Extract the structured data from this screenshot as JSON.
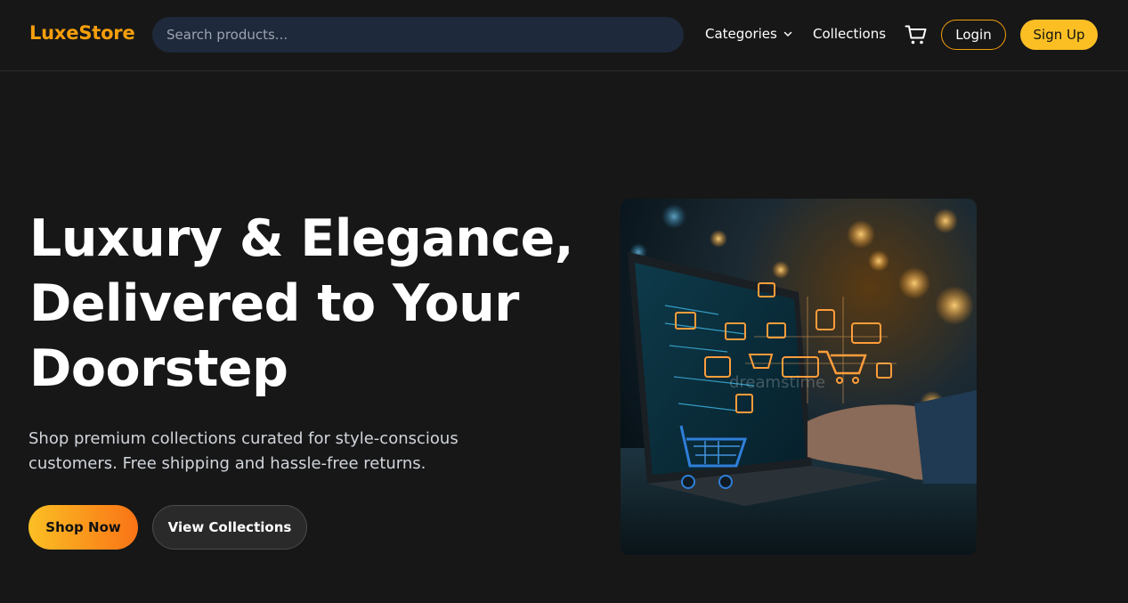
{
  "header": {
    "logo": "LuxeStore",
    "search": {
      "placeholder": "Search products...",
      "value": ""
    },
    "nav": {
      "categories": "Categories",
      "collections": "Collections"
    },
    "login": "Login",
    "signup": "Sign Up"
  },
  "hero": {
    "title": "Luxury & Elegance, Delivered to Your Doorstep",
    "subtitle": "Shop premium collections curated for style-conscious customers. Free shipping and hassle-free returns.",
    "primary_button": "Shop Now",
    "secondary_button": "View Collections",
    "image_watermark": "dreamstime"
  },
  "colors": {
    "accent": "#f59e0b",
    "background": "#171717",
    "search_bg": "#1e293b",
    "signup_bg": "#fbbf24"
  },
  "icons": {
    "cart": "shopping-cart-icon",
    "dropdown": "chevron-down-icon"
  }
}
